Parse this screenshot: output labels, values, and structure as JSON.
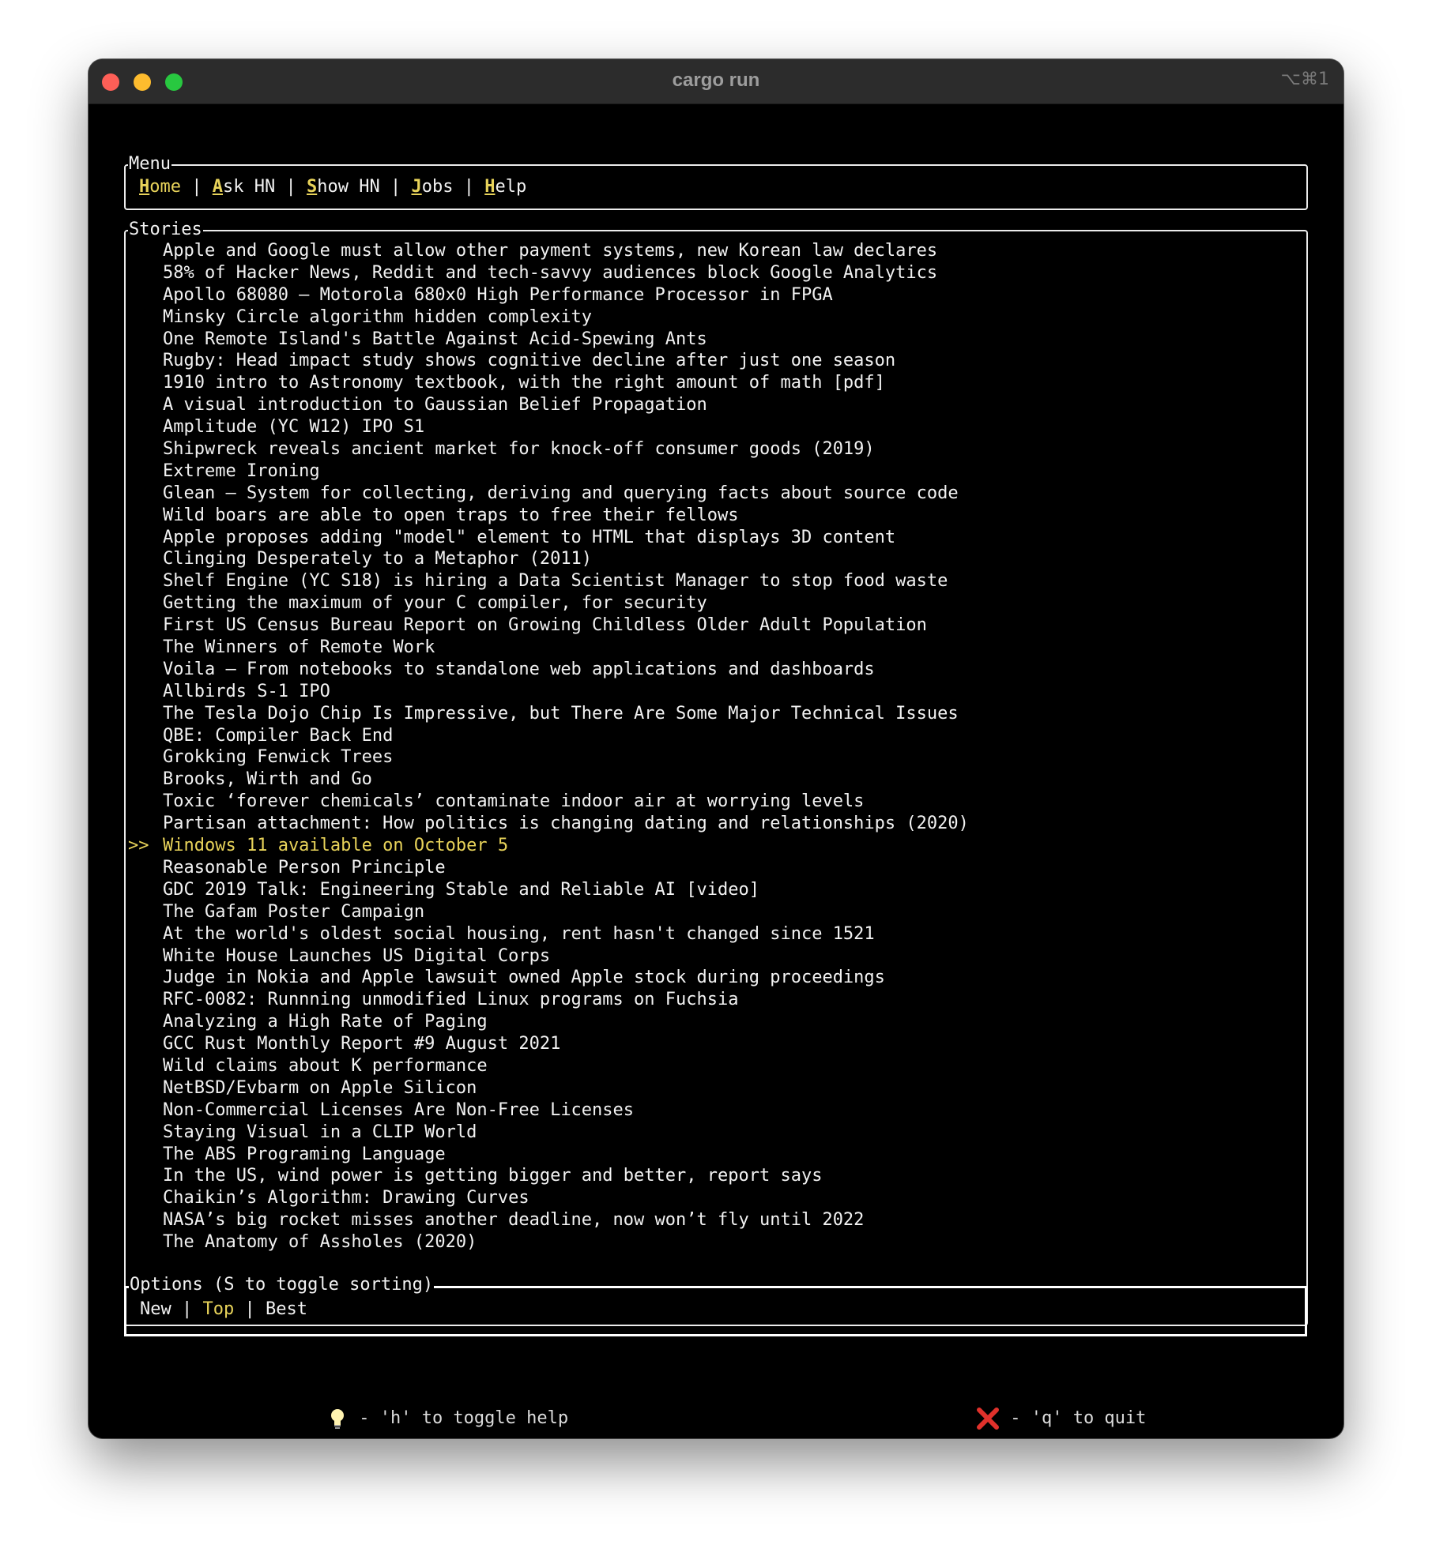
{
  "window": {
    "title": "cargo run",
    "shortcut": "⌥⌘1"
  },
  "menu": {
    "title": "Menu",
    "items": [
      {
        "hotkey": "H",
        "rest": "ome",
        "active": true
      },
      {
        "hotkey": "A",
        "rest": "sk HN",
        "active": false
      },
      {
        "hotkey": "S",
        "rest": "how HN",
        "active": false
      },
      {
        "hotkey": "J",
        "rest": "obs",
        "active": false
      },
      {
        "hotkey": "H",
        "rest": "elp",
        "active": false
      }
    ],
    "separator": " | "
  },
  "stories": {
    "title": "Stories",
    "cursor": ">>",
    "selected_index": 27,
    "items": [
      "Apple and Google must allow other payment systems, new Korean law declares",
      "58% of Hacker News, Reddit and tech-savvy audiences block Google Analytics",
      "Apollo 68080 – Motorola 680x0 High Performance Processor in FPGA",
      "Minsky Circle algorithm hidden complexity",
      "One Remote Island's Battle Against Acid-Spewing Ants",
      "Rugby: Head impact study shows cognitive decline after just one season",
      "1910 intro to Astronomy textbook, with the right amount of math [pdf]",
      "A visual introduction to Gaussian Belief Propagation",
      "Amplitude (YC W12) IPO S1",
      "Shipwreck reveals ancient market for knock-off consumer goods (2019)",
      "Extreme Ironing",
      "Glean – System for collecting, deriving and querying facts about source code",
      "Wild boars are able to open traps to free their fellows",
      "Apple proposes adding \"model\" element to HTML that displays 3D content",
      "Clinging Desperately to a Metaphor (2011)",
      "Shelf Engine (YC S18) is hiring a Data Scientist Manager to stop food waste",
      "Getting the maximum of your C compiler, for security",
      "First US Census Bureau Report on Growing Childless Older Adult Population",
      "The Winners of Remote Work",
      "Voila – From notebooks to standalone web applications and dashboards",
      "Allbirds S-1 IPO",
      "The Tesla Dojo Chip Is Impressive, but There Are Some Major Technical Issues",
      "QBE: Compiler Back End",
      "Grokking Fenwick Trees",
      "Brooks, Wirth and Go",
      "Toxic ‘forever chemicals’ contaminate indoor air at worrying levels",
      "Partisan attachment: How politics is changing dating and relationships (2020)",
      "Windows 11 available on October 5",
      "Reasonable Person Principle",
      "GDC 2019 Talk: Engineering Stable and Reliable AI [video]",
      "The Gafam Poster Campaign",
      "At the world's oldest social housing, rent hasn't changed since 1521",
      "White House Launches US Digital Corps",
      "Judge in Nokia and Apple lawsuit owned Apple stock during proceedings",
      "RFC-0082: Runnning unmodified Linux programs on Fuchsia",
      "Analyzing a High Rate of Paging",
      "GCC Rust Monthly Report #9 August 2021",
      "Wild claims about K performance",
      "NetBSD/Evbarm on Apple Silicon",
      "Non-Commercial Licenses Are Non-Free Licenses",
      "Staying Visual in a CLIP World",
      "The ABS Programing Language",
      "In the US, wind power is getting bigger and better, report says",
      "Chaikin’s Algorithm: Drawing Curves",
      "NASA’s big rocket misses another deadline, now won’t fly until 2022",
      "The Anatomy of Assholes (2020)"
    ]
  },
  "options": {
    "title": "Options (S to toggle sorting)",
    "items": [
      {
        "label": "New",
        "active": false
      },
      {
        "label": "Top",
        "active": true
      },
      {
        "label": "Best",
        "active": false
      }
    ],
    "separator": " | "
  },
  "footer": {
    "help_icon": "lightbulb-icon",
    "help_text": " - 'h' to toggle help",
    "quit_icon": "red-x-icon",
    "quit_text": " - 'q' to quit"
  },
  "colors": {
    "highlight": "#e8d35a",
    "text": "#f2f2f2",
    "background": "#000000"
  }
}
